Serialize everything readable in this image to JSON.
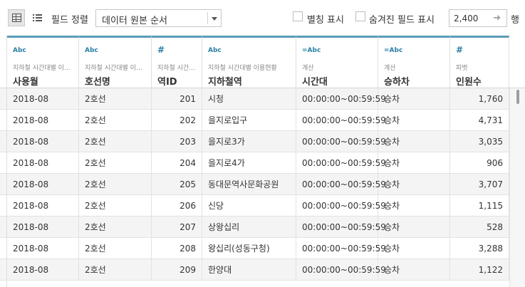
{
  "toolbar": {
    "sort_label": "필드 정렬",
    "sort_value": "데이터 원본 순서",
    "show_aliases_label": "별칭 표시",
    "show_hidden_label": "숨겨진 필드 표시",
    "row_count": "2,400",
    "row_unit": "행"
  },
  "columns": [
    {
      "type": "Abc",
      "source": "지하철 시간대별 이...",
      "name": "사용월"
    },
    {
      "type": "Abc",
      "source": "지하철 시간대별 이용현황",
      "name": "호선명"
    },
    {
      "type": "#",
      "source": "지하철 시간...",
      "name": "역ID"
    },
    {
      "type": "Abc",
      "source": "지하철 시간대별 이용현황",
      "name": "지하철역"
    },
    {
      "type": "=Abc",
      "source": "계산",
      "name": "시간대"
    },
    {
      "type": "=Abc",
      "source": "계산",
      "name": "승하차"
    },
    {
      "type": "#",
      "source": "피벗",
      "name": "인원수"
    }
  ],
  "rows": [
    [
      "2018-08",
      "2호선",
      "201",
      "시청",
      "00:00:00~00:59:59",
      "승차",
      "1,760"
    ],
    [
      "2018-08",
      "2호선",
      "202",
      "을지로입구",
      "00:00:00~00:59:59",
      "승차",
      "4,731"
    ],
    [
      "2018-08",
      "2호선",
      "203",
      "을지로3가",
      "00:00:00~00:59:59",
      "승차",
      "3,035"
    ],
    [
      "2018-08",
      "2호선",
      "204",
      "을지로4가",
      "00:00:00~00:59:59",
      "승차",
      "906"
    ],
    [
      "2018-08",
      "2호선",
      "205",
      "동대문역사문화공원",
      "00:00:00~00:59:59",
      "승차",
      "3,707"
    ],
    [
      "2018-08",
      "2호선",
      "206",
      "신당",
      "00:00:00~00:59:59",
      "승차",
      "1,115"
    ],
    [
      "2018-08",
      "2호선",
      "207",
      "상왕십리",
      "00:00:00~00:59:59",
      "승차",
      "528"
    ],
    [
      "2018-08",
      "2호선",
      "208",
      "왕십리(성동구청)",
      "00:00:00~00:59:59",
      "승차",
      "3,288"
    ],
    [
      "2018-08",
      "2호선",
      "209",
      "한양대",
      "00:00:00~00:59:59",
      "승차",
      "1,122"
    ]
  ],
  "colors": {
    "header_accent": "#5a9bb8",
    "type_icon": "#2a7fa5",
    "row_alt": "#f4f4f4"
  },
  "icons": {
    "grid_view": "grid-view-icon",
    "list_view": "list-view-icon",
    "dropdown": "chevron-down-icon",
    "row_arrow": "arrow-right-icon"
  }
}
